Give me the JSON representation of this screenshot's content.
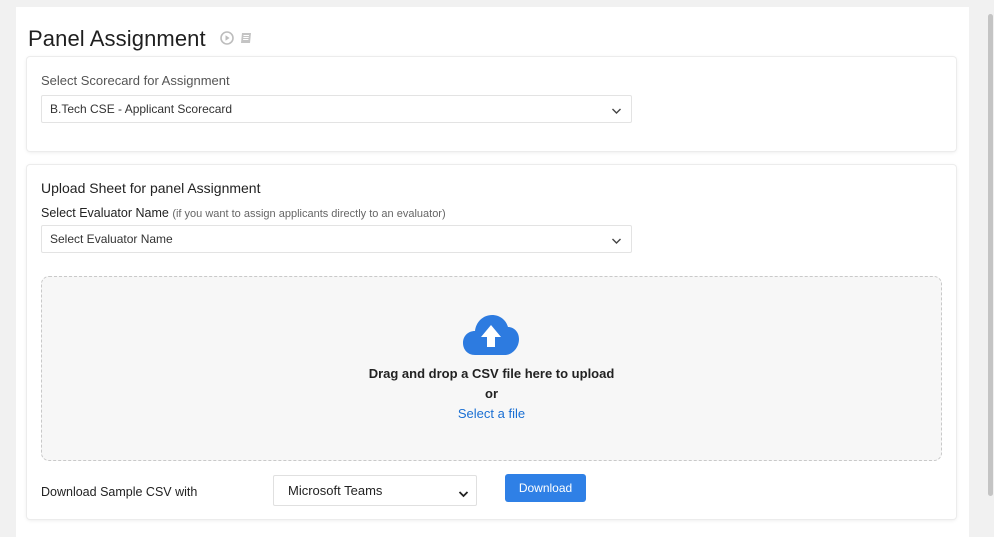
{
  "header": {
    "title": "Panel Assignment",
    "icons": [
      "play-circle-icon",
      "book-icon"
    ]
  },
  "scorecard": {
    "label": "Select Scorecard for Assignment",
    "selected": "B.Tech CSE - Applicant Scorecard"
  },
  "upload": {
    "heading": "Upload Sheet for panel Assignment",
    "evaluator_label": "Select Evaluator Name",
    "evaluator_hint": "(if you want to assign applicants directly to an evaluator)",
    "evaluator_selected": "Select Evaluator Name",
    "dropzone_text": "Drag and drop a CSV file here to upload",
    "dropzone_or": "or",
    "dropzone_link": "Select a file",
    "upload_icon": "cloud-upload-icon"
  },
  "sample": {
    "label": "Download Sample CSV with",
    "selected": "Microsoft Teams",
    "button": "Download"
  },
  "colors": {
    "accent": "#2f80e6",
    "link": "#1a6fd3",
    "cloud": "#2d7be0"
  }
}
